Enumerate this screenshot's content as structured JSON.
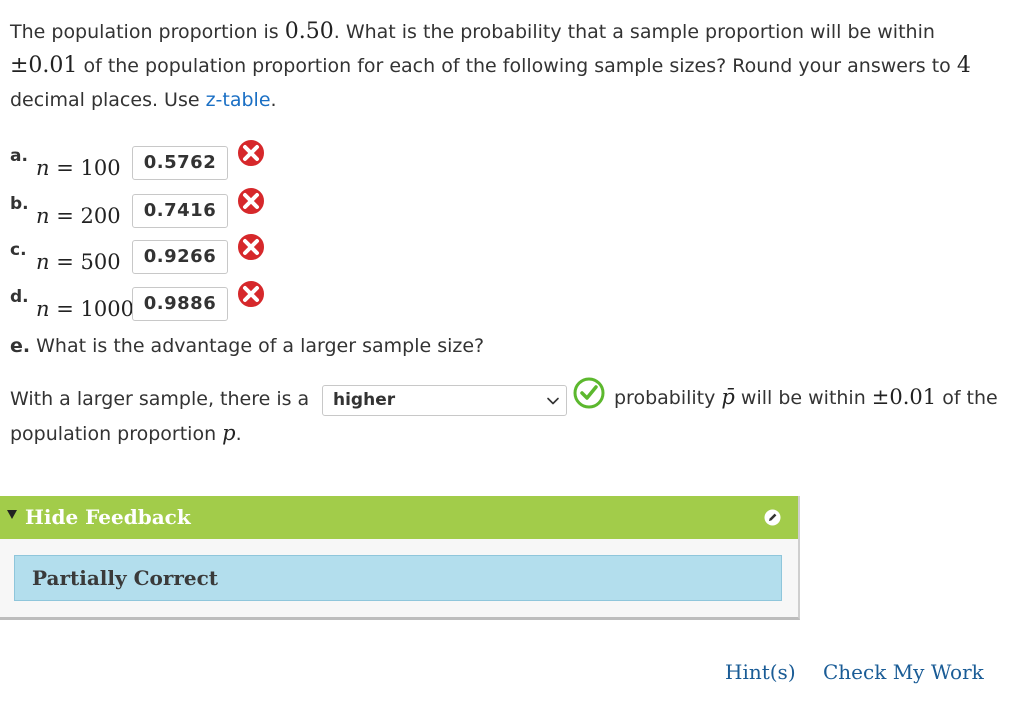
{
  "question": {
    "t1": "The population proportion is ",
    "p_value": "0.50",
    "t2": ". What is the probability that a sample proportion will be within ",
    "tolerance": "±0.01",
    "t3": " of the population proportion for each of the following sample sizes? Round your answers to ",
    "decimals": "4",
    "t4": " decimal places. Use ",
    "ztable_link": "z-table",
    "t5": "."
  },
  "parts": [
    {
      "letter": "a.",
      "n_symbol": "n",
      "eq": " = ",
      "n": "100",
      "answer": "0.5762",
      "status": "incorrect"
    },
    {
      "letter": "b.",
      "n_symbol": "n",
      "eq": " = ",
      "n": "200",
      "answer": "0.7416",
      "status": "incorrect"
    },
    {
      "letter": "c.",
      "n_symbol": "n",
      "eq": " = ",
      "n": "500",
      "answer": "0.9266",
      "status": "incorrect"
    },
    {
      "letter": "d.",
      "n_symbol": "n",
      "eq": " = ",
      "n": "1000",
      "answer": "0.9886",
      "status": "incorrect"
    }
  ],
  "part_e": {
    "letter": "e.",
    "question": " What is the advantage of a larger sample size?",
    "s1": "With a larger sample, there is a",
    "selected": "higher",
    "s2": "probability ",
    "pbar": "p̄",
    "s3": " will be within ",
    "tolerance": "±0.01",
    "s4": " of the",
    "s5": "population proportion ",
    "p": "p",
    "s6": ".",
    "status": "correct"
  },
  "feedback": {
    "toggle_label": "Hide Feedback",
    "result": "Partially Correct"
  },
  "footer": {
    "hint": "Hint(s)",
    "check": "Check My Work"
  },
  "colors": {
    "link": "#1a6fc4",
    "feedback_header": "#a2cc4a",
    "feedback_result_bg": "#b3deed",
    "incorrect_icon": "#d6282b",
    "correct_icon": "#5cb82e"
  },
  "icons": {
    "incorrect": "x-circle-icon",
    "correct": "check-circle-icon",
    "dropdown": "chevron-down-icon",
    "toggle": "triangle-down-icon",
    "edit": "pencil-icon"
  }
}
